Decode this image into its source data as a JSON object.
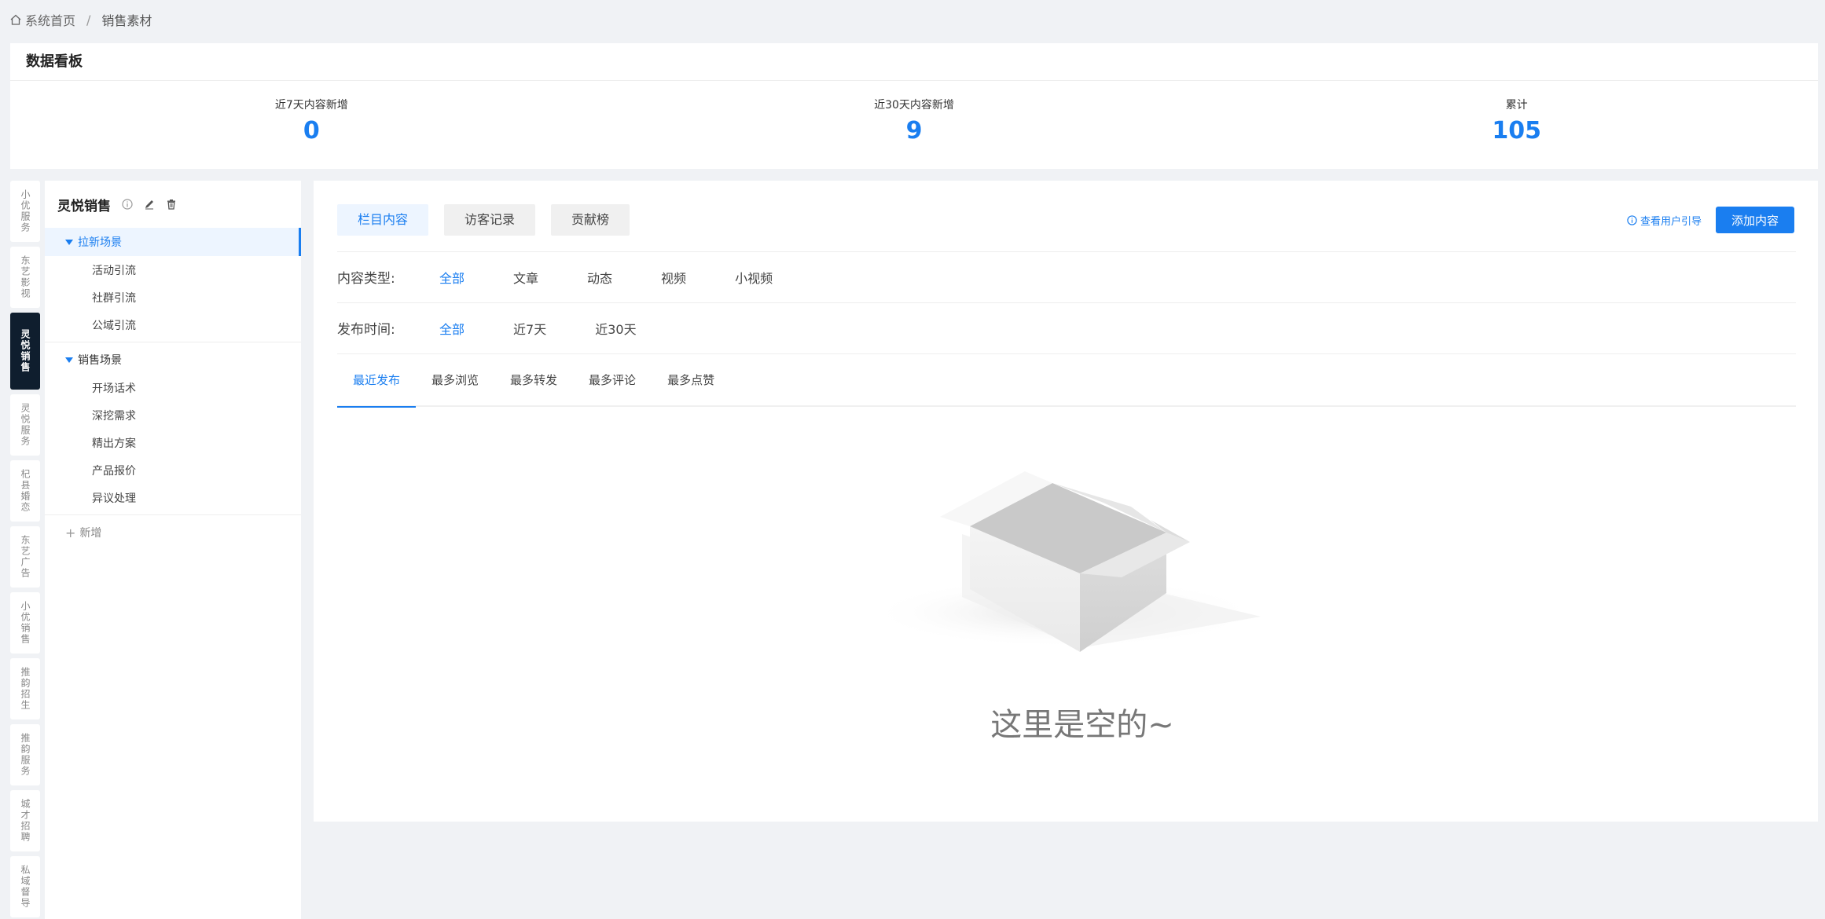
{
  "breadcrumb": {
    "home": "系统首页",
    "separator": "/",
    "current": "销售素材"
  },
  "dashboard": {
    "title": "数据看板",
    "stats": [
      {
        "label": "近7天内容新增",
        "value": "0"
      },
      {
        "label": "近30天内容新增",
        "value": "9"
      },
      {
        "label": "累计",
        "value": "105"
      }
    ]
  },
  "vtabs": [
    {
      "label": "小优服务"
    },
    {
      "label": "东艺影视"
    },
    {
      "label": "灵悦销售",
      "active": true
    },
    {
      "label": "灵悦服务"
    },
    {
      "label": "杞县婚恋"
    },
    {
      "label": "东艺广告"
    },
    {
      "label": "小优销售"
    },
    {
      "label": "推韵招生"
    },
    {
      "label": "推韵服务"
    },
    {
      "label": "城才招聘"
    },
    {
      "label": "私域督导"
    }
  ],
  "tree": {
    "title": "灵悦销售",
    "groups": [
      {
        "label": "拉新场景",
        "children": [
          "活动引流",
          "社群引流",
          "公域引流"
        ]
      },
      {
        "label": "销售场景",
        "children": [
          "开场话术",
          "深挖需求",
          "精出方案",
          "产品报价",
          "异议处理"
        ]
      }
    ],
    "add_label": "新增"
  },
  "main": {
    "tabs": [
      "栏目内容",
      "访客记录",
      "贡献榜"
    ],
    "guide_link": "查看用户引导",
    "add_button": "添加内容",
    "filters": {
      "content_type": {
        "label": "内容类型:",
        "options": [
          "全部",
          "文章",
          "动态",
          "视频",
          "小视频"
        ]
      },
      "publish_time": {
        "label": "发布时间:",
        "options": [
          "全部",
          "近7天",
          "近30天"
        ]
      }
    },
    "sort_tabs": [
      "最近发布",
      "最多浏览",
      "最多转发",
      "最多评论",
      "最多点赞"
    ],
    "empty_text": "这里是空的~"
  },
  "colors": {
    "accent": "#1a7ef0",
    "active_tab_bg": "#0f1e2e",
    "page_bg": "#f0f2f5"
  }
}
